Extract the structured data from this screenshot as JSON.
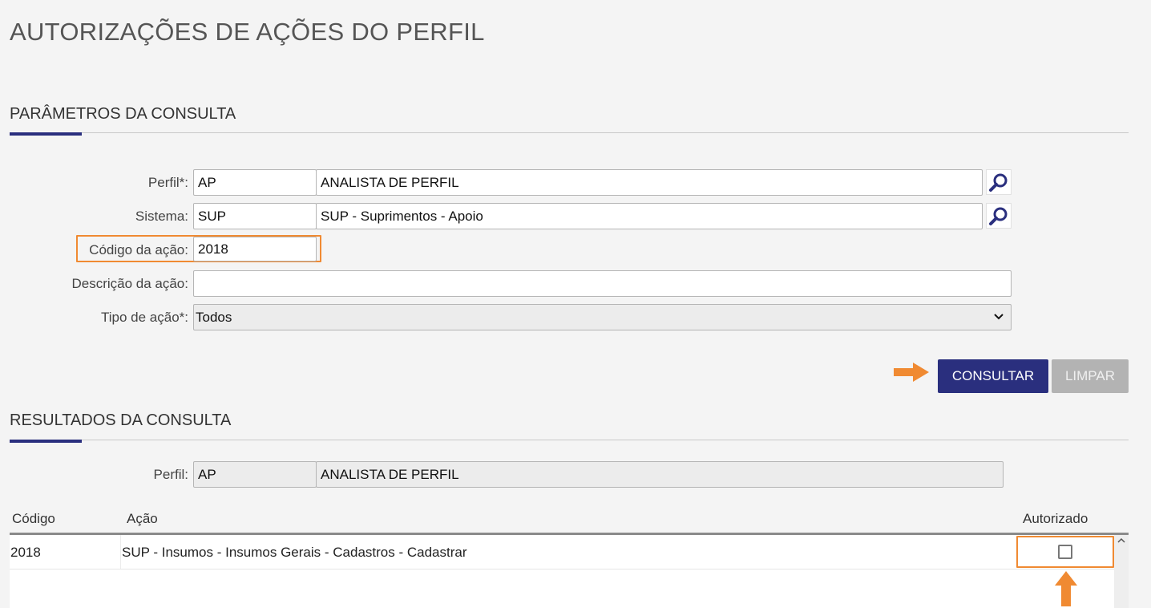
{
  "page": {
    "title": "AUTORIZAÇÕES DE AÇÕES DO PERFIL"
  },
  "params": {
    "section_title": "PARÂMETROS DA CONSULTA",
    "perfil": {
      "label": "Perfil*:",
      "code": "AP",
      "description": "ANALISTA DE PERFIL"
    },
    "sistema": {
      "label": "Sistema:",
      "code": "SUP",
      "description": "SUP - Suprimentos - Apoio"
    },
    "codigo_acao": {
      "label": "Código da ação:",
      "value": "2018"
    },
    "descricao_acao": {
      "label": "Descrição da ação:",
      "value": ""
    },
    "tipo_acao": {
      "label": "Tipo de ação*:",
      "selected": "Todos"
    },
    "buttons": {
      "consultar": "CONSULTAR",
      "limpar": "LIMPAR"
    }
  },
  "results": {
    "section_title": "RESULTADOS DA CONSULTA",
    "perfil": {
      "label": "Perfil:",
      "code": "AP",
      "description": "ANALISTA DE PERFIL"
    },
    "columns": {
      "codigo": "Código",
      "acao": "Ação",
      "autorizado": "Autorizado"
    },
    "rows": [
      {
        "codigo": "2018",
        "acao": "SUP - Insumos - Insumos Gerais - Cadastros - Cadastrar",
        "autorizado": false
      }
    ]
  },
  "colors": {
    "accent": "#2a2f7e",
    "highlight": "#f08a32",
    "disabled": "#b3b3b3"
  },
  "icons": {
    "search": "magnifier-icon",
    "dropdown": "chevron-down-icon",
    "arrow": "arrow-icon"
  }
}
